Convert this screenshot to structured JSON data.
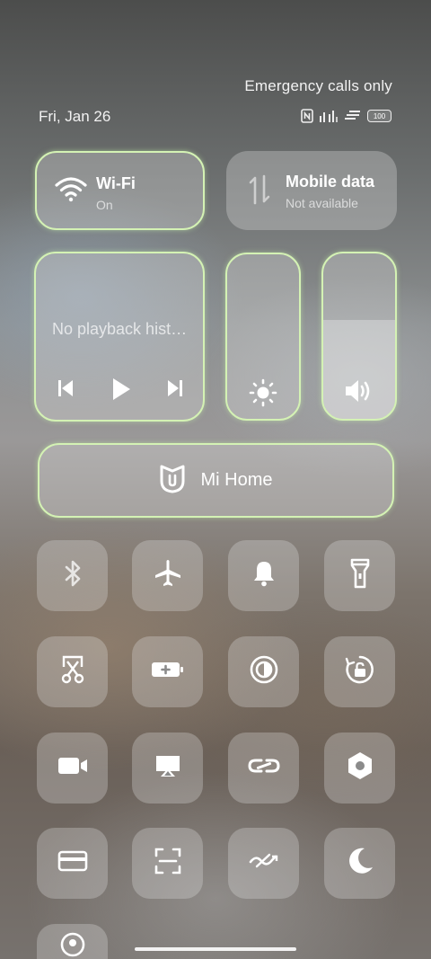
{
  "status_bar": {
    "carrier_text": "Emergency calls only",
    "date": "Fri, Jan 26",
    "battery": "100"
  },
  "tiles": {
    "wifi": {
      "title": "Wi-Fi",
      "status": "On",
      "icon": "wifi-icon"
    },
    "mobile_data": {
      "title": "Mobile data",
      "status": "Not available",
      "icon": "mobile-data-icon"
    }
  },
  "media": {
    "text": "No playback hist…",
    "controls": [
      "previous-icon",
      "play-icon",
      "next-icon"
    ]
  },
  "sliders": {
    "brightness": {
      "icon": "sun-icon",
      "level": 0
    },
    "volume": {
      "icon": "speaker-icon",
      "level": 0.6
    }
  },
  "mi_home": {
    "label": "Mi Home",
    "icon": "mi-home-icon"
  },
  "quick_toggles": [
    "bluetooth-icon",
    "airplane-icon",
    "bell-icon",
    "flashlight-icon",
    "screenshot-icon",
    "battery-saver-icon",
    "reading-mode-icon",
    "rotation-lock-icon",
    "video-icon",
    "cast-icon",
    "link-icon",
    "settings-icon",
    "card-icon",
    "scanner-icon",
    "data-saver-icon",
    "moon-icon",
    "location-icon"
  ],
  "colors": {
    "active_outline": "#d4f2b4"
  }
}
